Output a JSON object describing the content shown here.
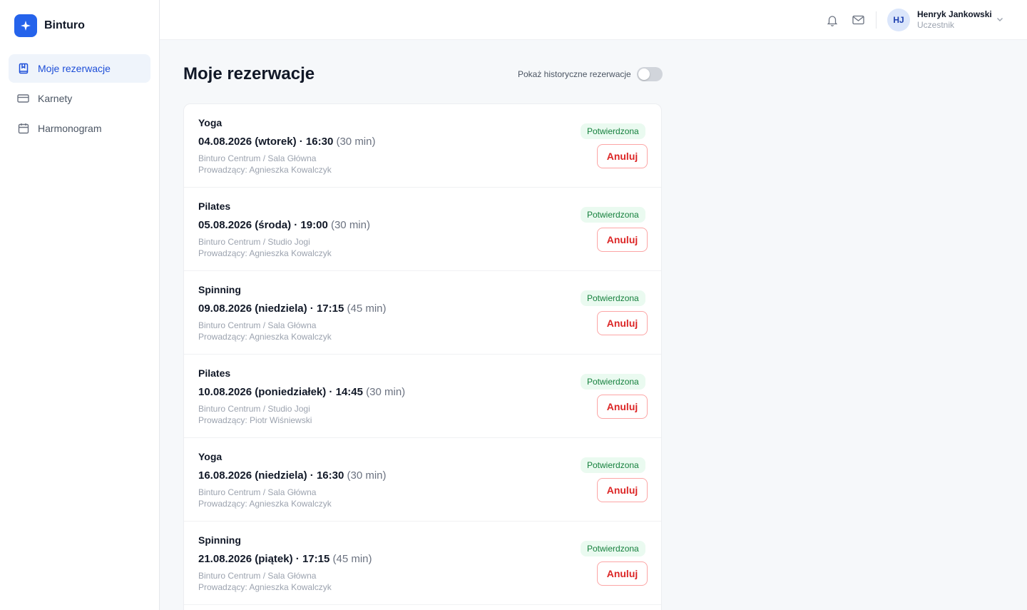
{
  "brand": {
    "name": "Binturo",
    "logo_icon": "sparkle-icon",
    "accent": "#2563eb"
  },
  "sidebar": {
    "items": [
      {
        "label": "Moje rezerwacje",
        "icon": "bookmark-book-icon",
        "active": true
      },
      {
        "label": "Karnety",
        "icon": "credit-card-icon",
        "active": false
      },
      {
        "label": "Harmonogram",
        "icon": "calendar-icon",
        "active": false
      }
    ]
  },
  "topbar": {
    "icons": [
      "bell-icon",
      "mail-icon"
    ],
    "user": {
      "initials": "HJ",
      "name": "Henryk Jankowski",
      "role": "Uczestnik"
    }
  },
  "main": {
    "title": "Moje rezerwacje",
    "history_toggle": {
      "label": "Pokaż historyczne rezerwacje",
      "on": false
    },
    "reservations": [
      {
        "name": "Yoga",
        "date": "04.08.2026 (wtorek)",
        "sep": " · ",
        "time": "16:30",
        "duration": "(30 min)",
        "place": "Binturo Centrum / Sala Główna",
        "trainer": "Prowadzący: Agnieszka Kowalczyk",
        "status": "Potwierdzona",
        "action": "Anuluj"
      },
      {
        "name": "Pilates",
        "date": "05.08.2026 (środa)",
        "sep": " · ",
        "time": "19:00",
        "duration": "(30 min)",
        "place": "Binturo Centrum / Studio Jogi",
        "trainer": "Prowadzący: Agnieszka Kowalczyk",
        "status": "Potwierdzona",
        "action": "Anuluj"
      },
      {
        "name": "Spinning",
        "date": "09.08.2026 (niedziela)",
        "sep": " · ",
        "time": "17:15",
        "duration": "(45 min)",
        "place": "Binturo Centrum / Sala Główna",
        "trainer": "Prowadzący: Agnieszka Kowalczyk",
        "status": "Potwierdzona",
        "action": "Anuluj"
      },
      {
        "name": "Pilates",
        "date": "10.08.2026 (poniedziałek)",
        "sep": " · ",
        "time": "14:45",
        "duration": "(30 min)",
        "place": "Binturo Centrum / Studio Jogi",
        "trainer": "Prowadzący: Piotr Wiśniewski",
        "status": "Potwierdzona",
        "action": "Anuluj"
      },
      {
        "name": "Yoga",
        "date": "16.08.2026 (niedziela)",
        "sep": " · ",
        "time": "16:30",
        "duration": "(30 min)",
        "place": "Binturo Centrum / Sala Główna",
        "trainer": "Prowadzący: Agnieszka Kowalczyk",
        "status": "Potwierdzona",
        "action": "Anuluj"
      },
      {
        "name": "Spinning",
        "date": "21.08.2026 (piątek)",
        "sep": " · ",
        "time": "17:15",
        "duration": "(45 min)",
        "place": "Binturo Centrum / Sala Główna",
        "trainer": "Prowadzący: Agnieszka Kowalczyk",
        "status": "Potwierdzona",
        "action": "Anuluj"
      }
    ]
  },
  "colors": {
    "accent": "#2563eb",
    "success_bg": "#eafaf0",
    "success_text": "#15803d",
    "danger": "#dc2626"
  }
}
